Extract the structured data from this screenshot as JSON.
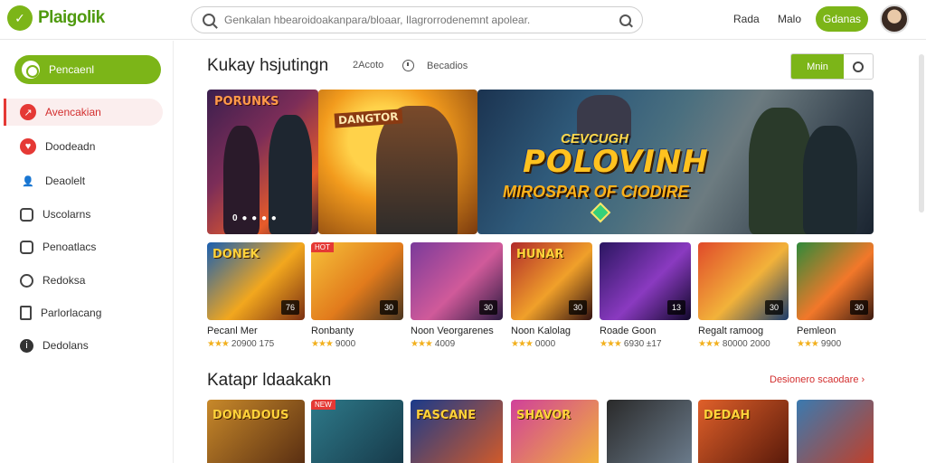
{
  "header": {
    "logo_text": "Plaigolik",
    "search_placeholder": "Genkalan hbearoidoakanpara/bloaar, Ilagrorrodenemnt apolear.",
    "nav": [
      "Rada",
      "Malo"
    ],
    "cta_label": "Gdanas"
  },
  "sidebar": {
    "top_button": "Pencaenl",
    "items": [
      {
        "label": "Avencakian",
        "icon": "arrow-icon",
        "active": true
      },
      {
        "label": "Doodeadn",
        "icon": "heart-icon",
        "active": false
      },
      {
        "label": "Deaolelt",
        "icon": "user-icon",
        "active": false
      },
      {
        "label": "Uscolarns",
        "icon": "bookmark-icon",
        "active": false
      },
      {
        "label": "Penoatlacs",
        "icon": "store-icon",
        "active": false
      },
      {
        "label": "Redoksa",
        "icon": "settings-icon",
        "active": false
      },
      {
        "label": "Parlorlacang",
        "icon": "document-icon",
        "active": false
      },
      {
        "label": "Dedolans",
        "icon": "info-icon",
        "active": false
      }
    ]
  },
  "section1": {
    "title": "Kukay hsjutingn",
    "info1": "2Acoto",
    "info2": "Becadios",
    "toggle_on": "Mnin"
  },
  "banners": [
    {
      "title": "PORUNKS",
      "caption": "0 ● ● ● ●"
    },
    {
      "title": "DANGTOR"
    },
    {
      "tag": "CEVCUGH",
      "title": "POLOVINH",
      "subtitle": "MIROSPAR OF CIODIRE"
    }
  ],
  "games": [
    {
      "name": "Pecanl Mer",
      "stars": "★★★",
      "count": "20900 175",
      "label": "DONEK",
      "badge": "76",
      "colors": [
        "#1a5fb0",
        "#f2a71e",
        "#7a2f12"
      ]
    },
    {
      "name": "Ronbanty",
      "stars": "★★★",
      "count": "9000",
      "label": "",
      "badge": "30",
      "colors": [
        "#f6c23a",
        "#e27b1c",
        "#4a3520"
      ],
      "hot": "HOT"
    },
    {
      "name": "Noon Veorgarenes",
      "stars": "★★★",
      "count": "4009",
      "label": "",
      "badge": "30",
      "colors": [
        "#7a3a9a",
        "#d05a9a",
        "#2b1a40"
      ]
    },
    {
      "name": "Noon Kalolag",
      "stars": "★★★",
      "count": "0000",
      "label": "HUNAR",
      "badge": "30",
      "colors": [
        "#b12a2a",
        "#f0a02a",
        "#301010"
      ]
    },
    {
      "name": "Roade Goon",
      "stars": "★★★",
      "count": "6930 ±17",
      "label": "",
      "badge": "13",
      "colors": [
        "#2a1660",
        "#8a3ac0",
        "#10082a"
      ]
    },
    {
      "name": "Regalt ramoog",
      "stars": "★★★",
      "count": "80000 2000",
      "label": "",
      "badge": "30",
      "colors": [
        "#e04a2a",
        "#f2b23a",
        "#1a3a6a"
      ]
    },
    {
      "name": "Pemleon",
      "stars": "★★★",
      "count": "9900",
      "label": "",
      "badge": "30",
      "colors": [
        "#2f8a3a",
        "#f2782a",
        "#3a1a10"
      ]
    }
  ],
  "section2": {
    "title": "Katapr ldaakakn",
    "see_all": "Desionero scaodare"
  },
  "games2": [
    {
      "label": "DONADOUS",
      "colors": [
        "#c8892a",
        "#5a2f12"
      ]
    },
    {
      "label": "",
      "colors": [
        "#2e7a8a",
        "#173a4a"
      ],
      "hot": "NEW"
    },
    {
      "label": "FASCANE",
      "colors": [
        "#1a3a8a",
        "#d05a2a"
      ]
    },
    {
      "label": "SHAVOR",
      "colors": [
        "#d0409a",
        "#f2b23a"
      ]
    },
    {
      "label": "",
      "colors": [
        "#2a2a2a",
        "#6a7a8a"
      ]
    },
    {
      "label": "DEDAH",
      "colors": [
        "#e0602a",
        "#5a1a0a"
      ]
    },
    {
      "label": "",
      "colors": [
        "#3a7ab0",
        "#c0402a"
      ]
    }
  ]
}
